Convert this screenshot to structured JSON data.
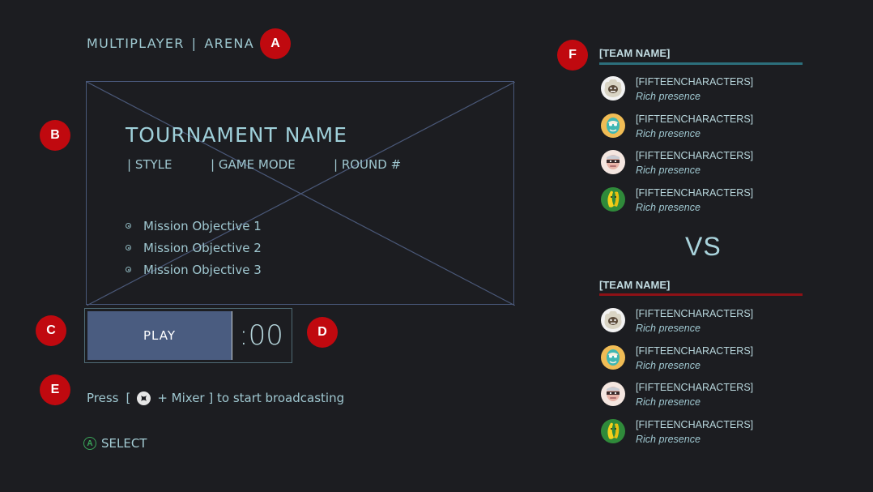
{
  "breadcrumb": {
    "section": "MULTIPLAYER",
    "separator": "|",
    "mode": "ARENA"
  },
  "callouts": [
    "A",
    "B",
    "C",
    "D",
    "E",
    "F"
  ],
  "tournament": {
    "name": "TOURNAMENT NAME",
    "style": "| STYLE",
    "game_mode": "| GAME MODE",
    "round": "| ROUND #",
    "objectives": [
      "Mission Objective 1",
      "Mission Objective 2",
      "Mission Objective 3"
    ]
  },
  "play": {
    "label": "PLAY",
    "timer": ":00"
  },
  "broadcast_hint": {
    "prefix": "Press",
    "open": "[",
    "suffix": "+ Mixer ] to start broadcasting",
    "icon": "xbox-guide-icon"
  },
  "select_hint": {
    "button": "A",
    "label": "SELECT"
  },
  "vs_label": "VS",
  "teams": [
    {
      "name": "[TEAM NAME]",
      "color": "#2c6f7c",
      "members": [
        {
          "gamertag": "[FIFTEENCHARACTERS]",
          "presence": "Rich presence",
          "avatar": "yeti-avatar"
        },
        {
          "gamertag": "[FIFTEENCHARACTERS]",
          "presence": "Rich presence",
          "avatar": "luchador-avatar"
        },
        {
          "gamertag": "[FIFTEENCHARACTERS]",
          "presence": "Rich presence",
          "avatar": "ninja-avatar"
        },
        {
          "gamertag": "[FIFTEENCHARACTERS]",
          "presence": "Rich presence",
          "avatar": "banana-avatar"
        }
      ]
    },
    {
      "name": "[TEAM NAME]",
      "color": "#8e1116",
      "members": [
        {
          "gamertag": "[FIFTEENCHARACTERS]",
          "presence": "Rich presence",
          "avatar": "yeti-avatar"
        },
        {
          "gamertag": "[FIFTEENCHARACTERS]",
          "presence": "Rich presence",
          "avatar": "luchador-avatar"
        },
        {
          "gamertag": "[FIFTEENCHARACTERS]",
          "presence": "Rich presence",
          "avatar": "ninja-avatar"
        },
        {
          "gamertag": "[FIFTEENCHARACTERS]",
          "presence": "Rich presence",
          "avatar": "banana-avatar"
        }
      ]
    }
  ],
  "colors": {
    "accent_play": "#4a5c80",
    "callout": "#c0090f",
    "select_green": "#3aa65a"
  }
}
